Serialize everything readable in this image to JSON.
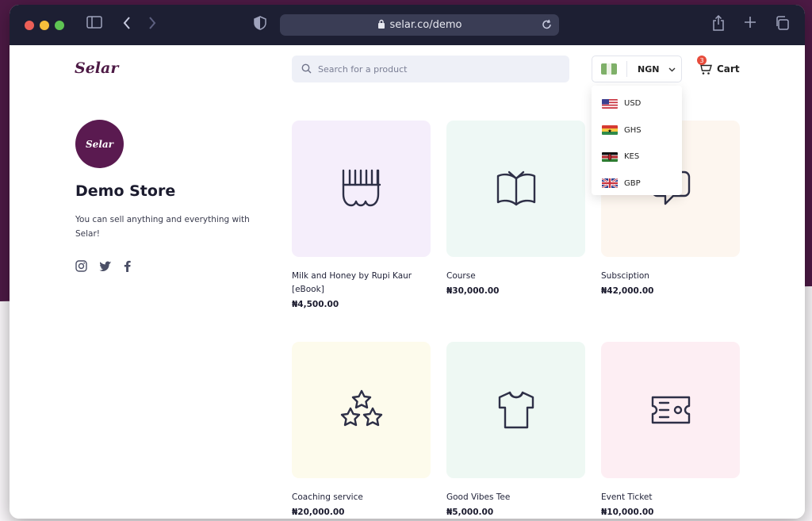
{
  "browser": {
    "url": "selar.co/demo"
  },
  "header": {
    "logo": "Selar",
    "search_placeholder": "Search for a product",
    "currency": "NGN",
    "cart_label": "Cart",
    "cart_count": "3"
  },
  "currency_dropdown": [
    {
      "code": "USD"
    },
    {
      "code": "GHS"
    },
    {
      "code": "KES"
    },
    {
      "code": "GBP"
    }
  ],
  "store": {
    "avatar_text": "Selar",
    "name": "Demo Store",
    "description": "You can sell anything and everything with Selar!"
  },
  "products": [
    {
      "name": "Milk and Honey by Rupi Kaur [eBook]",
      "price": "₦4,500.00",
      "icon": "comb-icon",
      "bg": "#f5eefb"
    },
    {
      "name": "Course",
      "price": "₦30,000.00",
      "icon": "open-book-icon",
      "bg": "#eef8f5"
    },
    {
      "name": "Subsciption",
      "price": "₦42,000.00",
      "icon": "chat-bubble-icon",
      "bg": "#fdf6ef"
    },
    {
      "name": "Coaching service",
      "price": "₦20,000.00",
      "icon": "three-stars-icon",
      "bg": "#fdfbec"
    },
    {
      "name": "Good Vibes Tee",
      "price": "₦5,000.00",
      "icon": "tshirt-icon",
      "bg": "#eef8f3"
    },
    {
      "name": "Event Ticket",
      "price": "₦10,000.00",
      "icon": "ticket-icon",
      "bg": "#fdeef3"
    }
  ]
}
